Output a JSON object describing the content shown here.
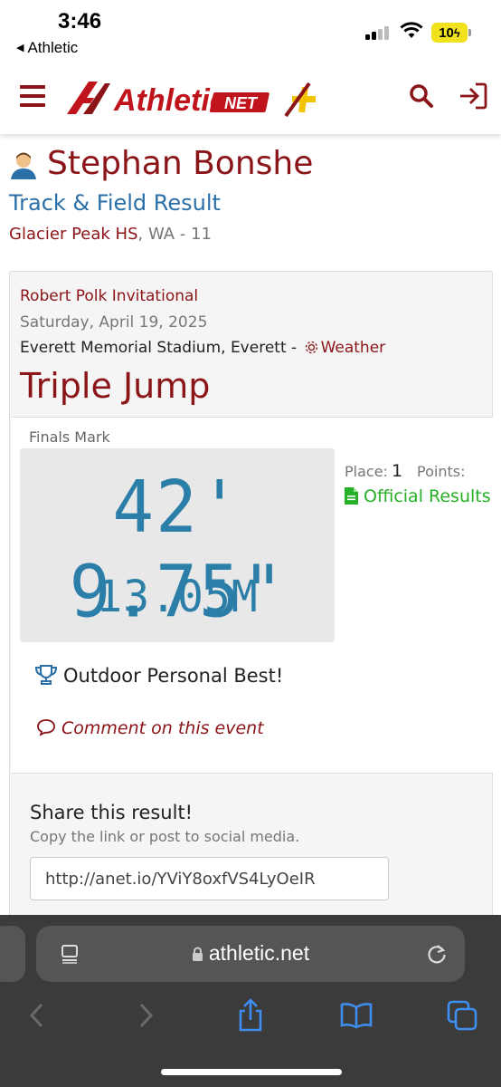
{
  "status_bar": {
    "time": "3:46",
    "back_app": "Athletic",
    "battery": "10"
  },
  "header": {
    "logo_text": "Athletic",
    "logo_net": "NET",
    "icons": [
      "hamburger-menu-icon",
      "search-icon",
      "login-icon"
    ],
    "colors": {
      "brand": "#8b1418",
      "accent": "#f2c300"
    }
  },
  "athlete": {
    "name": "Stephan Bonshe",
    "result_type": "Track & Field Result",
    "school": "Glacier Peak HS",
    "state_grade": ", WA - 11"
  },
  "meet": {
    "name": "Robert Polk Invitational",
    "date": "Saturday, April 19, 2025",
    "venue": "Everett Memorial Stadium, Everett - ",
    "weather_label": "Weather"
  },
  "event": {
    "name": "Triple Jump",
    "finals_label": "Finals Mark",
    "mark_imperial": "42' 9.75\"",
    "mark_metric": "13.05M",
    "place_label": "Place:",
    "place_value": "1",
    "points_label": "Points:",
    "official_label": "Official Results",
    "personal_best": "Outdoor Personal Best!",
    "comment_link": "Comment on this event"
  },
  "share": {
    "title": "Share this result!",
    "subtitle": "Copy the link or post to social media.",
    "link": "http://anet.io/YViY8oxfVS4LyOeIR"
  },
  "browser": {
    "address": "athletic.net"
  }
}
